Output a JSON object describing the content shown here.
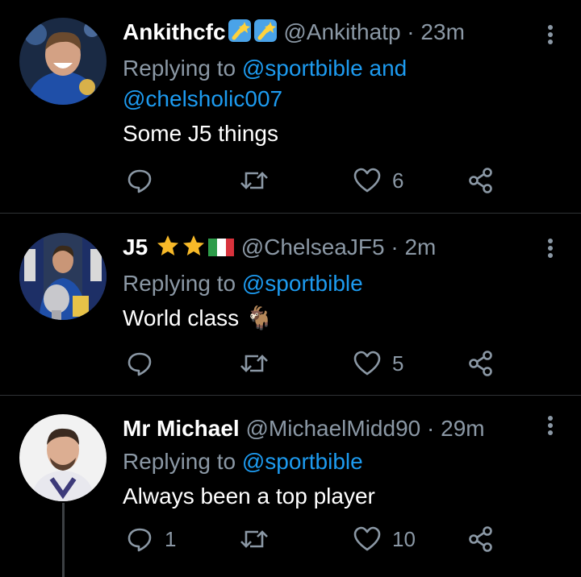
{
  "tweets": [
    {
      "name": "Ankithcfc",
      "handle": "@Ankithatp",
      "time": "23m",
      "replying_prefix": "Replying to ",
      "replying_to_1": "@sportbible",
      "replying_and": " and",
      "replying_to_2": "@chelsholic007",
      "text": "Some J5 things",
      "counts": {
        "reply": "",
        "retweet": "",
        "like": "6"
      }
    },
    {
      "name": "J5",
      "handle": "@ChelseaJF5",
      "time": "2m",
      "replying_prefix": "Replying to ",
      "replying_to_1": "@sportbible",
      "text": "World class 🐐",
      "counts": {
        "reply": "",
        "retweet": "",
        "like": "5"
      }
    },
    {
      "name": "Mr Michael",
      "handle": "@MichaelMidd90",
      "time": "29m",
      "replying_prefix": "Replying to ",
      "replying_to_1": "@sportbible",
      "text": "Always been a top player",
      "counts": {
        "reply": "1",
        "retweet": "",
        "like": "10"
      }
    }
  ],
  "separator": " · ",
  "colors": {
    "background": "#000000",
    "link": "#1d9bf0",
    "muted": "#8b98a5",
    "divider": "#2f3336"
  }
}
